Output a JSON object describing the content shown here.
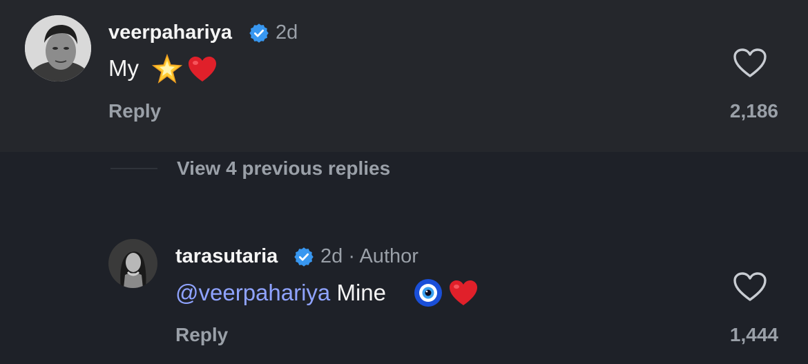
{
  "comments": [
    {
      "username": "veerpahariya",
      "verified": true,
      "time": "2d",
      "text": "My",
      "emojis": [
        "glowing-star",
        "red-heart"
      ],
      "reply_label": "Reply",
      "likes": "2,186"
    },
    {
      "username": "tarasutaria",
      "verified": true,
      "time": "2d",
      "separator": "·",
      "author_label": "Author",
      "mention": "@veerpahariya",
      "text": "Mine",
      "emojis": [
        "nazar-amulet",
        "red-heart"
      ],
      "reply_label": "Reply",
      "likes": "1,444"
    }
  ],
  "view_replies": "View 4 previous replies",
  "colors": {
    "background": "#1e2128",
    "highlight_bg": "#25272c",
    "text": "#f5f5f5",
    "muted": "#9aa0a8",
    "mention": "#8fa3ff",
    "verified": "#3897f0"
  }
}
